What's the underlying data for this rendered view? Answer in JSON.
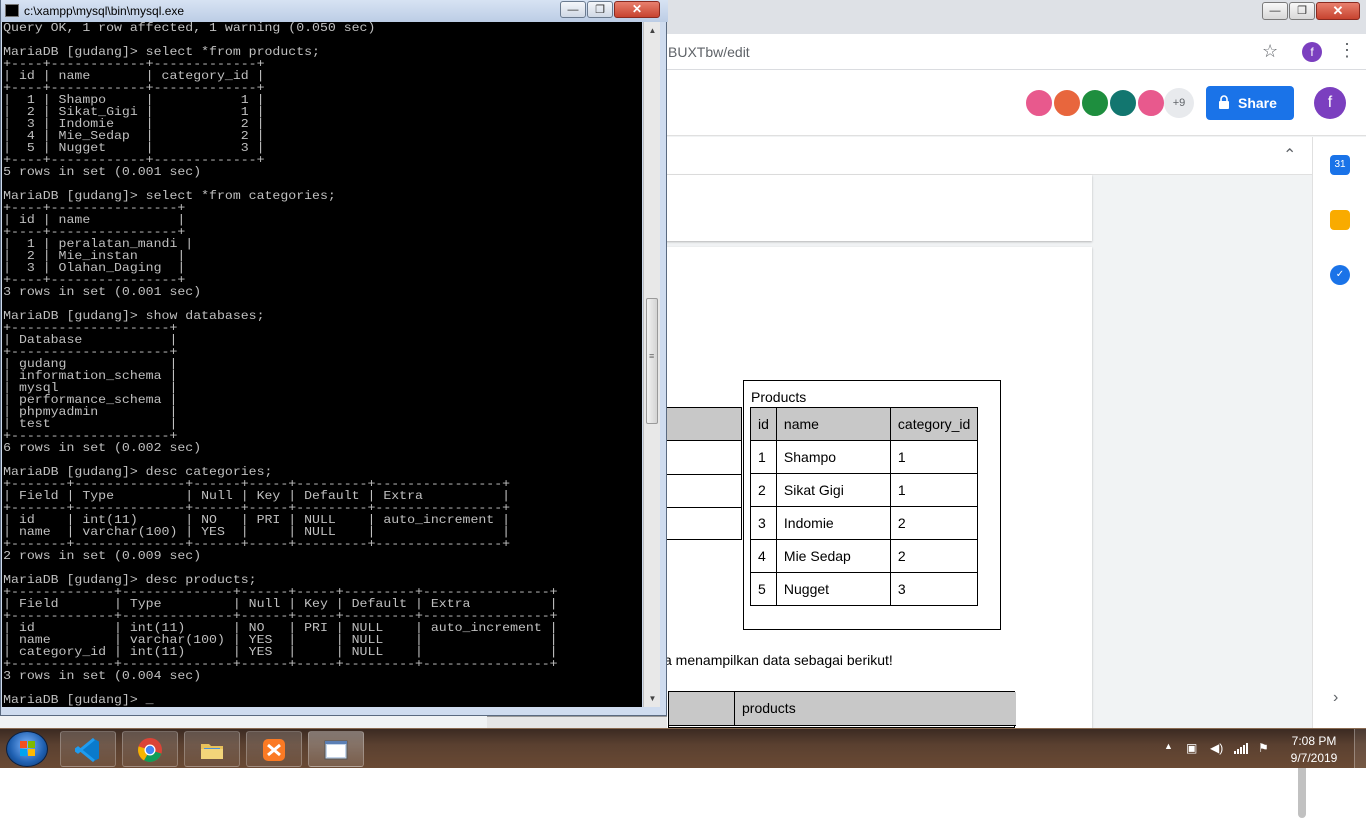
{
  "browser": {
    "url_text": "BUXTbw/edit",
    "star_icon": "☆",
    "profile_initial": "f",
    "menu_icon": "⋮",
    "window_close_glyph": "✕"
  },
  "docs": {
    "avatar_more": "+9",
    "share_label": "Share",
    "profile_initial": "f",
    "collapse_glyph": "⌃",
    "side_expand_glyph": "›",
    "products_caption": "Products",
    "products_table": {
      "headers": [
        "id",
        "name",
        "category_id"
      ],
      "rows": [
        [
          "1",
          "Shampo",
          "1"
        ],
        [
          "2",
          "Sikat Gigi",
          "1"
        ],
        [
          "3",
          "Indomie",
          "2"
        ],
        [
          "4",
          "Mie Sedap",
          "2"
        ],
        [
          "5",
          "Nugget",
          "3"
        ]
      ]
    },
    "sentence": "a menampilkan data sebagai berikut!",
    "bottom_table_header": "products",
    "avatar_colors": [
      "#e8598d",
      "#e8663d",
      "#1e8e3e",
      "#12766f",
      "#e8598d"
    ],
    "side_icon_colors": [
      "#1a73e8",
      "#f9ab00",
      "#1a73e8"
    ],
    "side_icon_labels": [
      "31",
      "",
      "✓"
    ]
  },
  "console": {
    "title": "c:\\xampp\\mysql\\bin\\mysql.exe",
    "close_glyph": "✕",
    "text": "Query OK, 1 row affected, 1 warning (0.050 sec)\n\nMariaDB [gudang]> select *from products;\n+----+------------+-------------+\n| id | name       | category_id |\n+----+------------+-------------+\n|  1 | Shampo     |           1 |\n|  2 | Sikat_Gigi |           1 |\n|  3 | Indomie    |           2 |\n|  4 | Mie_Sedap  |           2 |\n|  5 | Nugget     |           3 |\n+----+------------+-------------+\n5 rows in set (0.001 sec)\n\nMariaDB [gudang]> select *from categories;\n+----+----------------+\n| id | name           |\n+----+----------------+\n|  1 | peralatan_mandi |\n|  2 | Mie_instan     |\n|  3 | Olahan_Daging  |\n+----+----------------+\n3 rows in set (0.001 sec)\n\nMariaDB [gudang]> show databases;\n+--------------------+\n| Database           |\n+--------------------+\n| gudang             |\n| information_schema |\n| mysql              |\n| performance_schema |\n| phpmyadmin         |\n| test               |\n+--------------------+\n6 rows in set (0.002 sec)\n\nMariaDB [gudang]> desc categories;\n+-------+--------------+------+-----+---------+----------------+\n| Field | Type         | Null | Key | Default | Extra          |\n+-------+--------------+------+-----+---------+----------------+\n| id    | int(11)      | NO   | PRI | NULL    | auto_increment |\n| name  | varchar(100) | YES  |     | NULL    |                |\n+-------+--------------+------+-----+---------+----------------+\n2 rows in set (0.009 sec)\n\nMariaDB [gudang]> desc products;\n+-------------+--------------+------+-----+---------+----------------+\n| Field       | Type         | Null | Key | Default | Extra          |\n+-------------+--------------+------+-----+---------+----------------+\n| id          | int(11)      | NO   | PRI | NULL    | auto_increment |\n| name        | varchar(100) | YES  |     | NULL    |                |\n| category_id | int(11)      | YES  |     | NULL    |                |\n+-------------+--------------+------+-----+---------+----------------+\n3 rows in set (0.004 sec)\n\nMariaDB [gudang]> _"
  },
  "taskbar": {
    "clock_time": "7:08 PM",
    "clock_date": "9/7/2019",
    "apps": [
      "visual-studio-code",
      "google-chrome",
      "file-explorer",
      "xampp-control",
      "command-prompt"
    ]
  }
}
